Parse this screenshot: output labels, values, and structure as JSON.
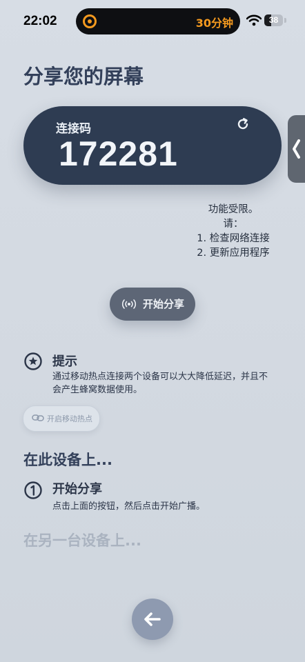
{
  "status_bar": {
    "time": "22:02",
    "island_label": "30分钟",
    "battery_level": "38",
    "battery_fraction": 0.38
  },
  "page": {
    "title": "分享您的屏幕"
  },
  "code_card": {
    "label": "连接码",
    "code": "172281",
    "refresh_icon": "refresh-icon"
  },
  "side_tab": {
    "icon": "chevron-left-icon"
  },
  "notice": {
    "line1": "功能受限。",
    "line2": "请：",
    "line3": "1. 检查网络连接",
    "line4": "2. 更新应用程序"
  },
  "share_button": {
    "label": "开始分享",
    "icon": "broadcast-icon"
  },
  "tip": {
    "title": "提示",
    "body": "通过移动热点连接两个设备可以大大降低延迟，并且不会产生蜂窝数据使用。",
    "icon": "star-icon",
    "hotspot_button_label": "开启移动热点",
    "hotspot_icon": "link-icon"
  },
  "this_device": {
    "title": "在此设备上...",
    "step_number_icon": "number-one-icon",
    "step_title": "开始分享",
    "step_desc": "点击上面的按钮，然后点击开始广播。"
  },
  "other_device": {
    "title": "在另一台设备上..."
  },
  "back_button": {
    "icon": "arrow-left-icon"
  },
  "colors": {
    "background": "#d5dbe3",
    "card": "#2e3c52",
    "accent_orange": "#f59a1f",
    "button_dark": "#5d6676",
    "back_button": "#8e9ab0"
  }
}
